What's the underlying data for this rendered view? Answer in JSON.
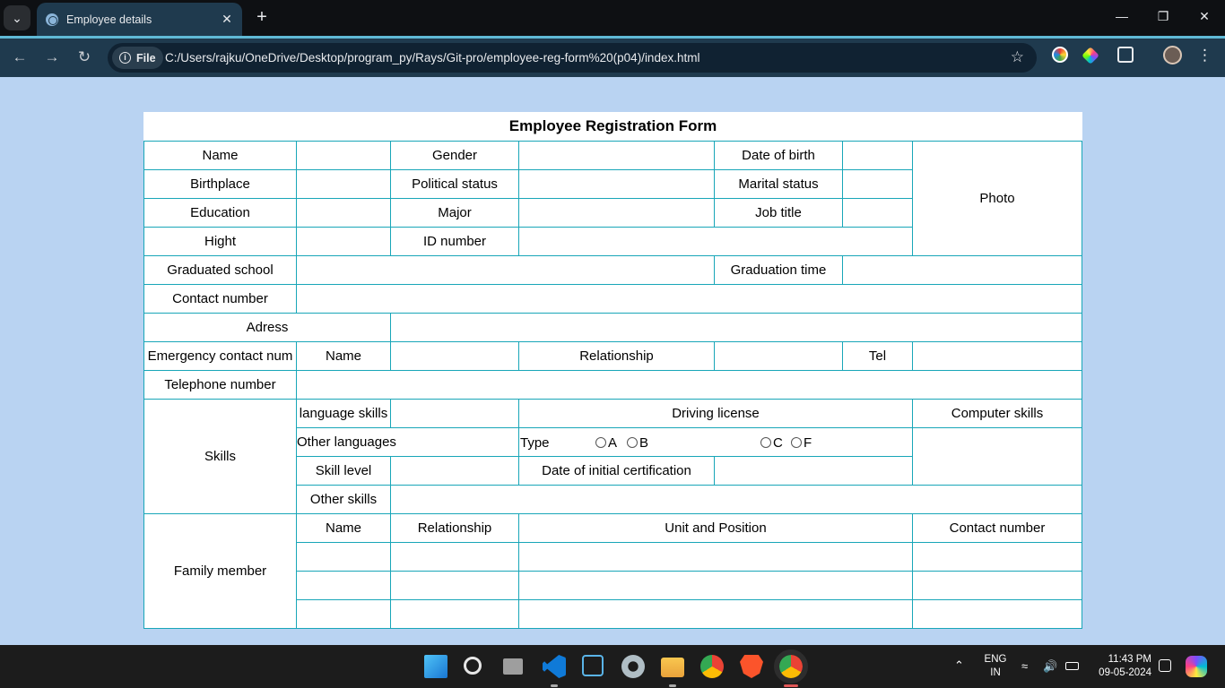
{
  "browser": {
    "tab_title": "Employee details",
    "chip_label": "File",
    "url": "C:/Users/rajku/OneDrive/Desktop/program_py/Rays/Git-pro/employee-reg-form%20(p04)/index.html"
  },
  "form": {
    "title": "Employee Registration Form",
    "name": "Name",
    "gender": "Gender",
    "dob": "Date of birth",
    "photo": "Photo",
    "birthplace": "Birthplace",
    "political_status": "Political status",
    "marital_status": "Marital status",
    "education": "Education",
    "major": "Major",
    "job_title": "Job title",
    "height": "Hight",
    "id_number": "ID number",
    "graduated_school": "Graduated school",
    "graduation_time": "Graduation time",
    "contact_number": "Contact number",
    "address": "Adress",
    "emergency_contact": "Emergency contact num",
    "ec_name": "Name",
    "ec_relationship": "Relationship",
    "ec_tel": "Tel",
    "telephone_number": "Telephone number",
    "skills": "Skills",
    "language_skills": "language skills",
    "driving_license": "Driving license",
    "computer_skills": "Computer skills",
    "other_languages": "Other languages",
    "type": "Type",
    "license_a": "A",
    "license_b": "B",
    "license_c": "C",
    "license_f": "F",
    "skill_level": "Skill level",
    "date_initial_cert": "Date of initial certification",
    "other_skills": "Other skills",
    "family_member": "Family member",
    "fm_name": "Name",
    "fm_relationship": "Relationship",
    "fm_unit_position": "Unit and Position",
    "fm_contact_number": "Contact number"
  },
  "taskbar": {
    "lang_top": "ENG",
    "lang_bottom": "IN",
    "time": "11:43 PM",
    "date": "09-05-2024"
  },
  "colors": {
    "page_background": "#b9d3f2",
    "table_border": "#18a6b8",
    "tab_accent": "#5fb9d6"
  }
}
